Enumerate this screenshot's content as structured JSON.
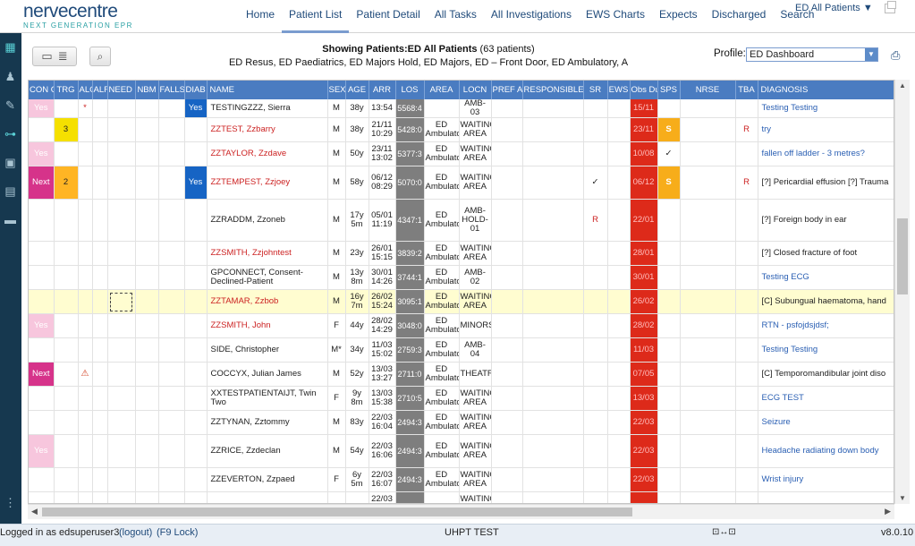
{
  "app": {
    "logo_name": "nervecentre",
    "logo_sub": "NEXT GENERATION EPR"
  },
  "nav": {
    "tabs": [
      "Home",
      "Patient List",
      "Patient Detail",
      "All Tasks",
      "All Investigations",
      "EWS Charts",
      "Expects",
      "Discharged",
      "Search"
    ],
    "active": "Patient List",
    "dropdown": "ED All Patients ▼"
  },
  "toolbar": {
    "showing_prefix": "Showing Patients:",
    "list_name": "ED All Patients",
    "count": "(63 patients)",
    "areas": "ED Resus, ED Paediatrics, ED Majors Hold, ED Majors, ED – Front Door, ED Ambulatory, A",
    "profile_label": "Profile:",
    "profile_value": "ED Dashboard"
  },
  "columns": [
    "CON CERN",
    "TRG",
    "ALG",
    "ALF",
    "NEED CUB",
    "NBM",
    "FALLS RISK",
    "DIAB",
    "NAME",
    "SEX",
    "AGE",
    "ARR",
    "LOS",
    "AREA",
    "LOCN",
    "PREF AREA",
    "RESPONSIBLE CLINICIAN",
    "SR",
    "EWS",
    "Obs Due",
    "SPS",
    "NRSE",
    "TBA",
    "DIAGNOSIS"
  ],
  "rows": [
    {
      "con": "Yes",
      "trg": "",
      "alg": "*",
      "diab": "Yes",
      "name": "TESTINGZZZ, Sierra",
      "sex": "M",
      "age": "38y",
      "arr": "13:54",
      "los": "5568:4",
      "area": "",
      "locn": "AMB-03",
      "sr": "",
      "obs": "15/11",
      "sps": "",
      "tba": "",
      "diag": "Testing Testing"
    },
    {
      "con": "",
      "trg": "3",
      "alg": "",
      "diab": "",
      "name": "ZZTEST, Zzbarry",
      "sex": "M",
      "age": "38y",
      "arr": "21/11 10:29",
      "los": "5428:0",
      "area": "ED Ambulatc",
      "locn": "WAITINC AREA",
      "sr": "",
      "obs": "23/11",
      "sps": "S",
      "tba": "R",
      "diag": "try"
    },
    {
      "con": "Yes",
      "trg": "",
      "alg": "",
      "diab": "",
      "name": "ZZTAYLOR, Zzdave",
      "sex": "M",
      "age": "50y",
      "arr": "23/11 13:02",
      "los": "5377:3",
      "area": "ED Ambulatc",
      "locn": "WAITINC AREA",
      "sr": "",
      "obs": "10/08",
      "sps": "✓",
      "tba": "",
      "diag": "fallen off ladder - 3 metres?"
    },
    {
      "con": "Next",
      "trg": "2",
      "alg": "",
      "diab": "Yes",
      "name": "ZZTEMPEST, Zzjoey",
      "sex": "M",
      "age": "58y",
      "arr": "06/12 08:29",
      "los": "5070:0",
      "area": "ED Ambulatc",
      "locn": "WAITINC AREA",
      "sr": "✓",
      "obs": "06/12",
      "sps": "S",
      "tba": "R",
      "diag": "[?] Pericardial effusion [?] Trauma"
    },
    {
      "con": "",
      "trg": "",
      "alg": "",
      "diab": "",
      "name": "ZZRADDM, Zzoneb",
      "sex": "M",
      "age": "17y 5m",
      "arr": "05/01 11:19",
      "los": "4347:1",
      "area": "ED Ambulatc",
      "locn": "AMB-HOLD-01",
      "sr": "R",
      "obs": "22/01",
      "sps": "",
      "tba": "",
      "diag": "[?] Foreign body in ear"
    },
    {
      "con": "",
      "trg": "",
      "alg": "",
      "diab": "",
      "name": "ZZSMITH, Zzjohntest",
      "sex": "M",
      "age": "23y",
      "arr": "26/01 15:15",
      "los": "3839:2",
      "area": "ED Ambulatc",
      "locn": "WAITINC AREA",
      "sr": "",
      "obs": "28/01",
      "sps": "",
      "tba": "",
      "diag": "[?] Closed fracture of foot"
    },
    {
      "con": "",
      "trg": "",
      "alg": "",
      "diab": "",
      "name": "GPCONNECT, Consent-Declined-Patient",
      "sex": "M",
      "age": "13y 8m",
      "arr": "30/01 14:26",
      "los": "3744:1",
      "area": "ED Ambulatc",
      "locn": "AMB-02",
      "sr": "",
      "obs": "30/01",
      "sps": "",
      "tba": "",
      "diag": "Testing ECG"
    },
    {
      "con": "",
      "trg": "",
      "alg": "",
      "diab": "",
      "name": "ZZTAMAR, Zzbob",
      "sex": "M",
      "age": "16y 7m",
      "arr": "26/02 15:24",
      "los": "3095:1",
      "area": "ED Ambulatc",
      "locn": "WAITINC AREA",
      "sr": "",
      "obs": "26/02",
      "sps": "",
      "tba": "",
      "diag": "[C] Subungual haematoma, hand"
    },
    {
      "con": "Yes",
      "trg": "",
      "alg": "",
      "diab": "",
      "name": "ZZSMITH, John",
      "sex": "F",
      "age": "44y",
      "arr": "28/02 14:29",
      "los": "3048:0",
      "area": "ED Ambulatc",
      "locn": "MINORS",
      "sr": "",
      "obs": "28/02",
      "sps": "",
      "tba": "",
      "diag": "RTN - psfojdsjdsf;"
    },
    {
      "con": "",
      "trg": "",
      "alg": "",
      "diab": "",
      "name": "SIDE, Christopher",
      "sex": "M*",
      "age": "34y",
      "arr": "11/03 15:02",
      "los": "2759:3",
      "area": "ED Ambulatc",
      "locn": "AMB-04",
      "sr": "",
      "obs": "11/03",
      "sps": "",
      "tba": "",
      "diag": "Testing Testing"
    },
    {
      "con": "Next",
      "trg": "",
      "alg": "⚠",
      "diab": "",
      "name": "COCCYX, Julian James",
      "sex": "M",
      "age": "52y",
      "arr": "13/03 13:27",
      "los": "2711:0",
      "area": "ED Ambulatc",
      "locn": "THEATR",
      "sr": "",
      "obs": "07/05",
      "sps": "",
      "tba": "",
      "diag": "[C] Temporomandibular joint diso"
    },
    {
      "con": "",
      "trg": "",
      "alg": "",
      "diab": "",
      "name": "XXTESTPATIENTAIJT, Twin Two",
      "sex": "F",
      "age": "9y 8m",
      "arr": "13/03 15:38",
      "los": "2710:5",
      "area": "ED Ambulatc",
      "locn": "WAITINC AREA",
      "sr": "",
      "obs": "13/03",
      "sps": "",
      "tba": "",
      "diag": "ECG TEST"
    },
    {
      "con": "",
      "trg": "",
      "alg": "",
      "diab": "",
      "name": "ZZTYNAN, Zztommy",
      "sex": "M",
      "age": "83y",
      "arr": "22/03 16:04",
      "los": "2494:3",
      "area": "ED Ambulatc",
      "locn": "WAITINC AREA",
      "sr": "",
      "obs": "22/03",
      "sps": "",
      "tba": "",
      "diag": "Seizure"
    },
    {
      "con": "Yes",
      "trg": "",
      "alg": "",
      "diab": "",
      "name": "ZZRICE, Zzdeclan",
      "sex": "M",
      "age": "54y",
      "arr": "22/03 16:06",
      "los": "2494:3",
      "area": "ED Ambulatc",
      "locn": "WAITINC AREA",
      "sr": "",
      "obs": "22/03",
      "sps": "",
      "tba": "",
      "diag": "Headache radiating down body"
    },
    {
      "con": "",
      "trg": "",
      "alg": "",
      "diab": "",
      "name": "ZZEVERTON, Zzpaed",
      "sex": "F",
      "age": "6y 5m",
      "arr": "22/03 16:07",
      "los": "2494:3",
      "area": "ED Ambulatc",
      "locn": "WAITINC AREA",
      "sr": "",
      "obs": "22/03",
      "sps": "",
      "tba": "",
      "diag": "Wrist injury"
    },
    {
      "con": "",
      "trg": "",
      "alg": "",
      "diab": "",
      "name": "",
      "sex": "",
      "age": "",
      "arr": "22/03",
      "los": "",
      "area": "",
      "locn": "WAITINC",
      "sr": "",
      "obs": "",
      "sps": "",
      "tba": "",
      "diag": ""
    }
  ],
  "status": {
    "logged_in": "Logged in as edsuperuser3",
    "logout": "(logout)",
    "lock": "(F9 Lock)",
    "site": "UHPT TEST",
    "version": "v8.0.10"
  },
  "icons": [
    "network-icon",
    "person-icon",
    "pen-icon",
    "pathway-icon",
    "bin-icon",
    "clipboard-icon",
    "bed-icon",
    "more-icon",
    "list-view-icon",
    "compact-view-icon",
    "search-icon",
    "print-icon",
    "dropdown-arrow-icon",
    "network-status-icon",
    "popout-icon"
  ]
}
